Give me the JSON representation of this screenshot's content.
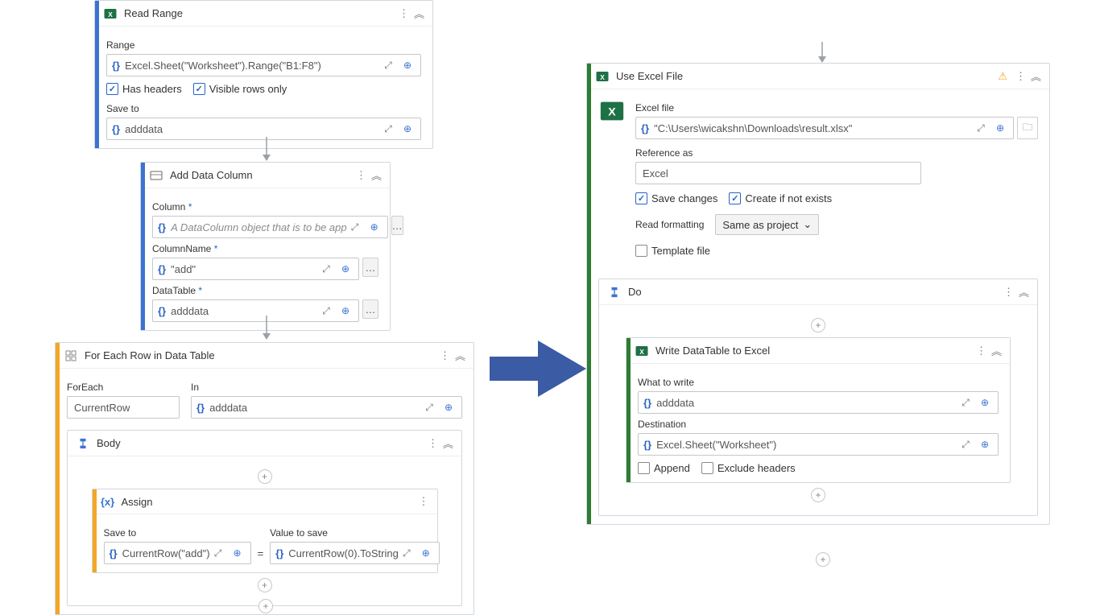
{
  "readRange": {
    "title": "Read Range",
    "rangeLabel": "Range",
    "rangeValue": "Excel.Sheet(\"Worksheet\").Range(\"B1:F8\")",
    "hasHeaders": "Has headers",
    "visibleRows": "Visible rows only",
    "saveToLabel": "Save to",
    "saveToValue": "adddata"
  },
  "addDataColumn": {
    "title": "Add Data Column",
    "columnLabel": "Column",
    "columnPlaceholder": "A DataColumn object that is to be app",
    "columnNameLabel": "ColumnName",
    "columnNameValue": "\"add\"",
    "dataTableLabel": "DataTable",
    "dataTableValue": "adddata"
  },
  "forEach": {
    "title": "For Each Row in Data Table",
    "forEachLabel": "ForEach",
    "forEachValue": "CurrentRow",
    "inLabel": "In",
    "inValue": "adddata",
    "bodyTitle": "Body",
    "assignTitle": "Assign",
    "saveToLabel": "Save to",
    "saveToValue": "CurrentRow(\"add\")",
    "eqSign": "=",
    "valueToSaveLabel": "Value to save",
    "valueToSaveValue": "CurrentRow(0).ToString"
  },
  "useExcel": {
    "title": "Use Excel File",
    "excelFileLabel": "Excel file",
    "excelFileValue": "\"C:\\Users\\wicakshn\\Downloads\\result.xlsx\"",
    "referenceAsLabel": "Reference as",
    "referenceValue": "Excel",
    "saveChanges": "Save changes",
    "createIfNotExists": "Create if not exists",
    "readFormattingLabel": "Read formatting",
    "readFormattingValue": "Same as project",
    "templateFile": "Template file",
    "doTitle": "Do",
    "writeTitle": "Write DataTable to Excel",
    "whatToWriteLabel": "What to write",
    "whatToWriteValue": "adddata",
    "destinationLabel": "Destination",
    "destinationValue": "Excel.Sheet(\"Worksheet\")",
    "append": "Append",
    "excludeHeaders": "Exclude headers"
  }
}
